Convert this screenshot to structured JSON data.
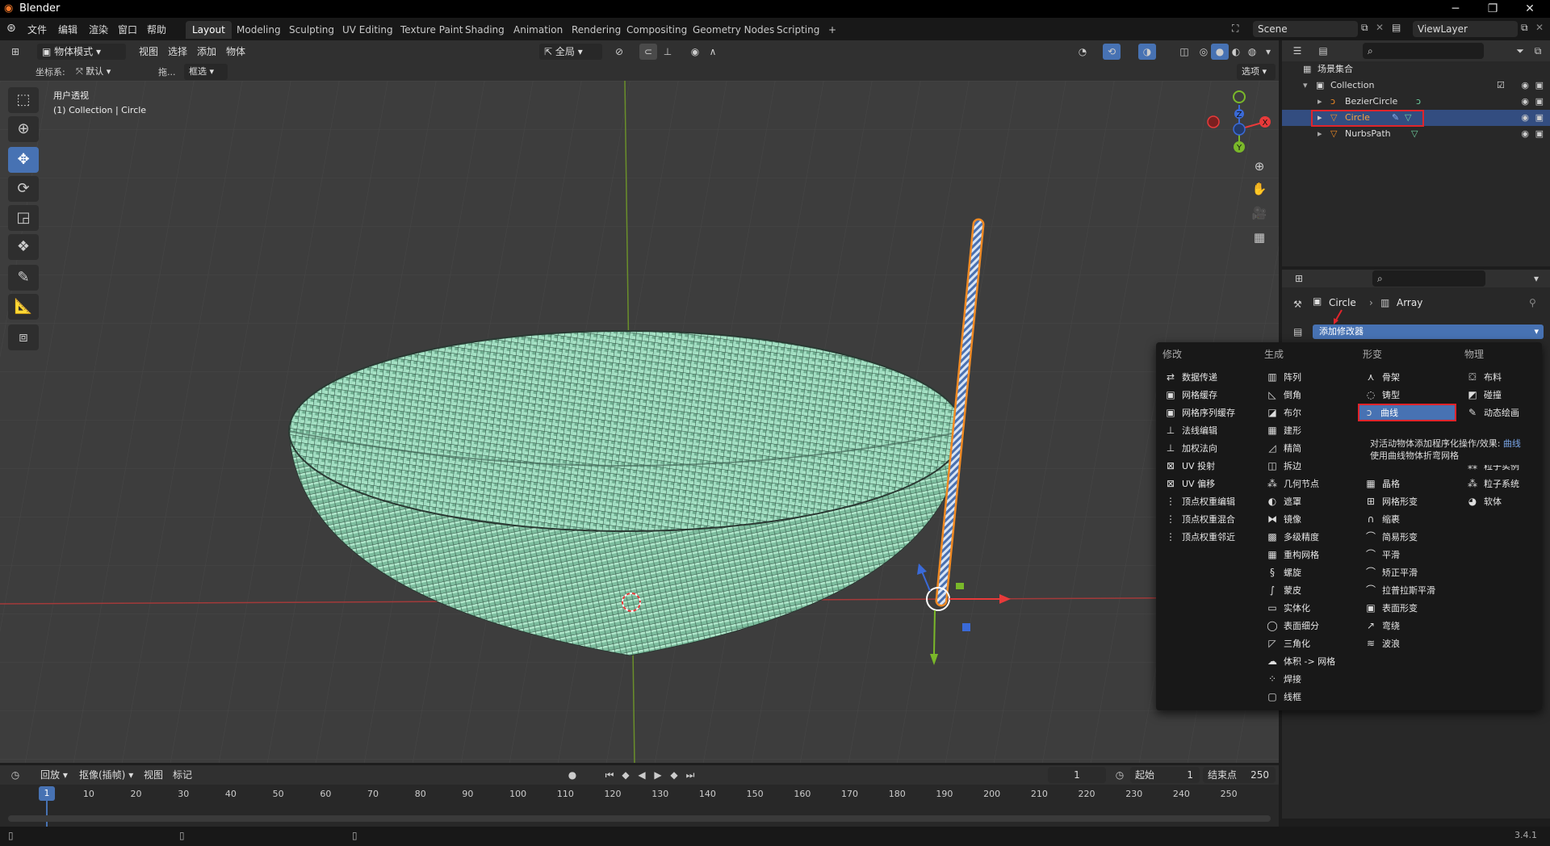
{
  "app": {
    "title": "Blender",
    "version": "3.4.1"
  },
  "menu": [
    "文件",
    "编辑",
    "渲染",
    "窗口",
    "帮助"
  ],
  "workspaces": [
    "Layout",
    "Modeling",
    "Sculpting",
    "UV Editing",
    "Texture Paint",
    "Shading",
    "Animation",
    "Rendering",
    "Compositing",
    "Geometry Nodes",
    "Scripting",
    "+"
  ],
  "active_workspace": "Layout",
  "scene": {
    "name": "Scene",
    "view_layer": "ViewLayer"
  },
  "viewport_header": {
    "mode": "物体模式",
    "menus": [
      "视图",
      "选择",
      "添加",
      "物体"
    ],
    "transform_orientation": "全局"
  },
  "tool_header": {
    "coord_label": "坐标系:",
    "coord_value": "默认",
    "drag_label": "拖...",
    "select_mode": "框选",
    "options": "选项"
  },
  "viewport": {
    "view_name": "用户透视",
    "collection_info": "(1) Collection | Circle"
  },
  "toolbar": [
    "select-box-icon",
    "cursor-icon",
    "move-icon",
    "rotate-icon",
    "scale-icon",
    "transform-icon",
    "annotate-icon",
    "measure-icon",
    "add-cube-icon"
  ],
  "gizmo": {
    "x": "X",
    "y": "Y",
    "z": "Z"
  },
  "outliner": {
    "root": "场景集合",
    "collection": "Collection",
    "objects": [
      "BezierCircle",
      "Circle",
      "NurbsPath"
    ],
    "selected": "Circle"
  },
  "properties": {
    "breadcrumb_object": "Circle",
    "breadcrumb_modifier": "Array",
    "add_modifier": "添加修改器"
  },
  "modifier_menu": {
    "columns": [
      {
        "header": "修改",
        "items": [
          "数据传递",
          "网格缓存",
          "网格序列缓存",
          "法线编辑",
          "加权法向",
          "UV 投射",
          "UV 偏移",
          "顶点权重编辑",
          "顶点权重混合",
          "顶点权重邻近"
        ]
      },
      {
        "header": "生成",
        "items": [
          "阵列",
          "倒角",
          "布尔",
          "建形",
          "精简",
          "拆边",
          "几何节点",
          "遮罩",
          "镜像",
          "多级精度",
          "重构网格",
          "螺旋",
          "蒙皮",
          "实体化",
          "表面细分",
          "三角化",
          "体积 -> 网格",
          "焊接",
          "线框"
        ]
      },
      {
        "header": "形变",
        "items": [
          "骨架",
          "铸型",
          "曲线",
          "",
          "",
          "",
          "晶格",
          "网格形变",
          "缩裹",
          "简易形变",
          "平滑",
          "矫正平滑",
          "拉普拉斯平滑",
          "表面形变",
          "弯绕",
          "波浪"
        ]
      },
      {
        "header": "物理",
        "items": [
          "布料",
          "碰撞",
          "动态绘画",
          "",
          "",
          "粒子实例",
          "粒子系统",
          "软体"
        ]
      }
    ],
    "highlighted": "曲线",
    "tooltip": {
      "line1": "对活动物体添加程序化操作/效果:",
      "link": "曲线",
      "line2": "使用曲线物体折弯网格"
    }
  },
  "timeline": {
    "playback": "回放",
    "keying": "抠像(插帧)",
    "view": "视图",
    "marker": "标记",
    "current_frame": "1",
    "start_label": "起始",
    "start": "1",
    "end_label": "结束点",
    "end": "250",
    "ticks": [
      "1",
      "10",
      "20",
      "30",
      "40",
      "50",
      "60",
      "70",
      "80",
      "90",
      "100",
      "110",
      "120",
      "130",
      "140",
      "150",
      "160",
      "170",
      "180",
      "190",
      "200",
      "210",
      "220",
      "230",
      "240",
      "250"
    ]
  },
  "colors": {
    "accent": "#4772b3",
    "highlight_box": "#e0242b",
    "basket": "#8fd1b0",
    "selected_outline": "#f08a24"
  }
}
